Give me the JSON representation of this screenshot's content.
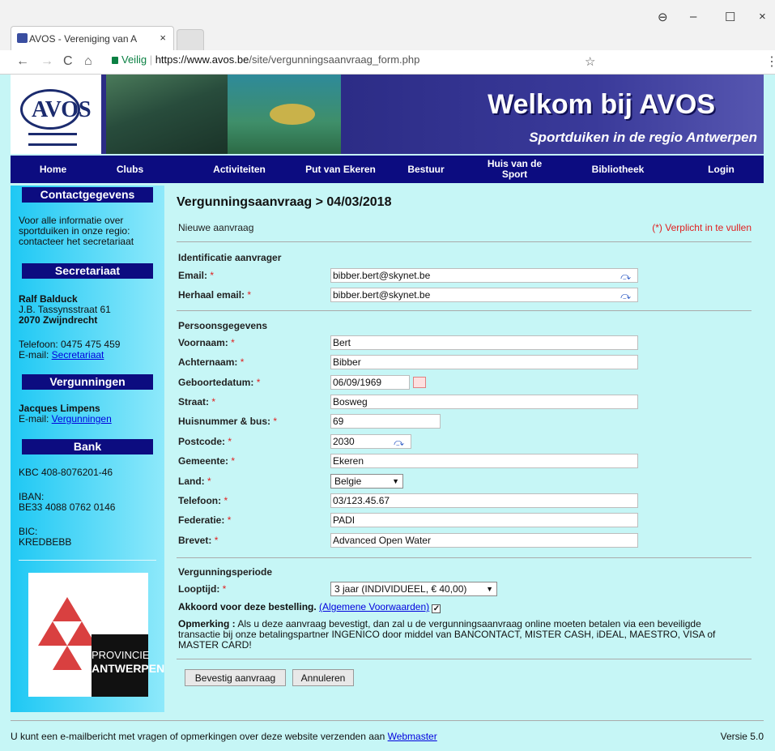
{
  "browser": {
    "tab_title": "AVOS - Vereniging van A",
    "tab_close": "×",
    "secure_label": "Veilig",
    "url_host": "https://www.avos.be",
    "url_path": "/site/vergunningsaanvraag_form.php",
    "nav_back": "←",
    "nav_forward": "→",
    "nav_reload": "C",
    "nav_home": "⌂",
    "bookmark": "☆",
    "win_profile": "⊖",
    "win_minimize": "–",
    "win_maximize": "☐",
    "win_close": "×",
    "menu": "⋮"
  },
  "banner": {
    "logo_text": "AVOS",
    "welcome": "Welkom bij AVOS",
    "subtitle": "Sportduiken in de regio Antwerpen"
  },
  "nav": {
    "items": [
      "Home",
      "Clubs",
      "Activiteiten",
      "Put van Ekeren",
      "Bestuur",
      "Huis van de Sport",
      "Bibliotheek",
      "Login"
    ]
  },
  "sidebar": {
    "contact_head": "Contactgegevens",
    "contact_text": "Voor alle informatie over sportduiken in onze regio: contacteer het secretariaat",
    "secretariaat_head": "Secretariaat",
    "sec_name": "Ralf Balduck",
    "sec_street": "J.B. Tassynsstraat 61",
    "sec_city": "2070 Zwijndrecht",
    "sec_phone": "Telefoon: 0475 475 459",
    "sec_email_label": "E-mail: ",
    "sec_email_link": "Secretariaat",
    "vergunningen_head": "Vergunningen",
    "verg_name": "Jacques Limpens",
    "verg_email_label": "E-mail: ",
    "verg_email_link": "Vergunningen",
    "bank_head": "Bank",
    "bank_kbc": "KBC 408-8076201-46",
    "iban_label": "IBAN:",
    "iban_value": "BE33 4088 0762 0146",
    "bic_label": "BIC:",
    "bic_value": "KREDBEBB",
    "prov_line1": "PROVINCIE",
    "prov_line2": "ANTWERPEN"
  },
  "form": {
    "title": "Vergunningsaanvraag > 04/03/2018",
    "new_request": "Nieuwe aanvraag",
    "required_note": "(*) Verplicht in te vullen",
    "section_id": "Identificatie aanvrager",
    "email_label": "Email:",
    "email_value": "bibber.bert@skynet.be",
    "email2_label": "Herhaal email:",
    "email2_value": "bibber.bert@skynet.be",
    "section_person": "Persoonsgegevens",
    "voornaam_label": "Voornaam:",
    "voornaam_value": "Bert",
    "achternaam_label": "Achternaam:",
    "achternaam_value": "Bibber",
    "geboorte_label": "Geboortedatum:",
    "geboorte_value": "06/09/1969",
    "straat_label": "Straat:",
    "straat_value": "Bosweg",
    "huisnr_label": "Huisnummer & bus:",
    "huisnr_value": "69",
    "postcode_label": "Postcode:",
    "postcode_value": "2030",
    "gemeente_label": "Gemeente:",
    "gemeente_value": "Ekeren",
    "land_label": "Land:",
    "land_value": "Belgie",
    "telefoon_label": "Telefoon:",
    "telefoon_value": "03/123.45.67",
    "federatie_label": "Federatie:",
    "federatie_value": "PADI",
    "brevet_label": "Brevet:",
    "brevet_value": "Advanced Open Water",
    "section_period": "Vergunningsperiode",
    "looptijd_label": "Looptijd:",
    "looptijd_value": "3 jaar (INDIVIDUEEL, € 40,00)",
    "agree_label": "Akkoord voor deze bestelling.",
    "agree_link": "(Algemene Voorwaarden)",
    "agree_checked": "✓",
    "remark_label": "Opmerking :",
    "remark_text": "Als u deze aanvraag bevestigt, dan zal u de vergunningsaanvraag online moeten betalen via een beveiligde transactie bij onze betalingspartner INGENICO door middel van BANCONTACT, MISTER CASH, iDEAL, MAESTRO, VISA of MASTER CARD!",
    "confirm_button": "Bevestig aanvraag",
    "cancel_button": "Annuleren",
    "star": "*"
  },
  "footer": {
    "text": "U kunt een e-mailbericht met vragen of opmerkingen over deze website verzenden aan ",
    "link": "Webmaster",
    "version": "Versie 5.0"
  },
  "colors": {
    "page_bg": "#c6f6f6",
    "nav_bg": "#0c0c80",
    "sidebar_bg": "#1ec8f4",
    "required": "#e02020",
    "link": "#0000dd"
  }
}
